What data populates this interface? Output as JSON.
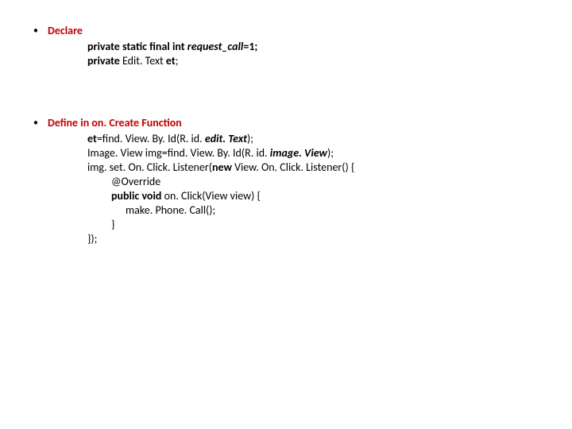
{
  "sections": [
    {
      "title": "Declare",
      "lines": [
        {
          "indent": 0,
          "runs": [
            {
              "t": "private static final int ",
              "cls": "b"
            },
            {
              "t": "request_call",
              "cls": "bi"
            },
            {
              "t": "=1;",
              "cls": "b"
            }
          ]
        },
        {
          "indent": 0,
          "runs": [
            {
              "t": "private ",
              "cls": "b"
            },
            {
              "t": "Edit. Text ",
              "cls": ""
            },
            {
              "t": "et",
              "cls": "b"
            },
            {
              "t": ";",
              "cls": ""
            }
          ]
        }
      ]
    },
    {
      "title": "Define in on. Create Function",
      "lines": [
        {
          "indent": 0,
          "runs": [
            {
              "t": "et",
              "cls": "b"
            },
            {
              "t": "=find. View. By. Id(R. id. ",
              "cls": ""
            },
            {
              "t": "edit. Text",
              "cls": "bi"
            },
            {
              "t": ");",
              "cls": ""
            }
          ]
        },
        {
          "indent": 0,
          "runs": [
            {
              "t": "Image. View img=find. View. By. Id(R. id. ",
              "cls": ""
            },
            {
              "t": "image. View",
              "cls": "bi"
            },
            {
              "t": ");",
              "cls": ""
            }
          ]
        },
        {
          "indent": 0,
          "runs": [
            {
              "t": "img. set. On. Click. Listener(",
              "cls": ""
            },
            {
              "t": "new ",
              "cls": "b"
            },
            {
              "t": "View. On. Click. Listener() {",
              "cls": ""
            }
          ]
        },
        {
          "indent": 1,
          "runs": [
            {
              "t": "@Override",
              "cls": ""
            }
          ]
        },
        {
          "indent": 1,
          "runs": [
            {
              "t": "public void ",
              "cls": "b"
            },
            {
              "t": "on. Click(View view) {",
              "cls": ""
            }
          ]
        },
        {
          "indent": 2,
          "runs": [
            {
              "t": "make. Phone. Call();",
              "cls": ""
            }
          ]
        },
        {
          "indent": 1,
          "runs": [
            {
              "t": "}",
              "cls": ""
            }
          ]
        },
        {
          "indent": 0,
          "runs": [
            {
              "t": "});",
              "cls": ""
            }
          ]
        }
      ]
    }
  ],
  "bullet_glyph": "•"
}
